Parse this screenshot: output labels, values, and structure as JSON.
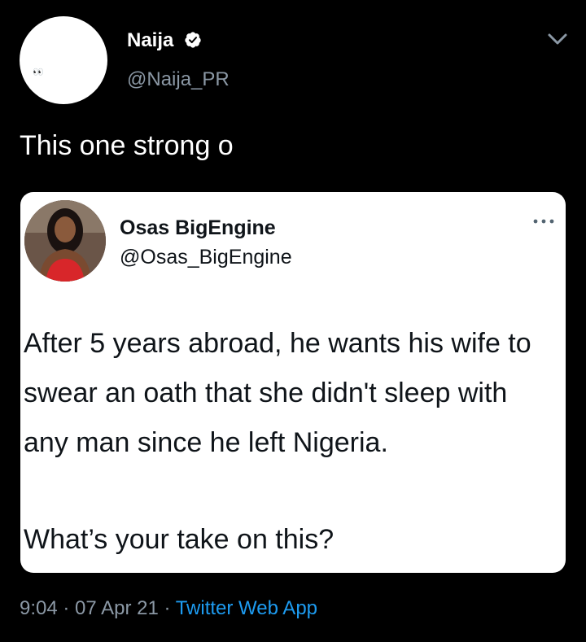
{
  "author": {
    "display_name": "Naija",
    "handle": "@Naija_PR",
    "avatar_emoji": "👀",
    "verified": true
  },
  "tweet": {
    "text": "This one strong o"
  },
  "quoted": {
    "display_name": "Osas BigEngine",
    "handle": "@Osas_BigEngine",
    "body": "After 5 years abroad, he wants his wife to swear an oath that she didn't sleep with any man since he left Nigeria.",
    "question": "What’s your take on this?"
  },
  "meta": {
    "time": "9:04",
    "separator": " · ",
    "date": "07 Apr 21",
    "separator2": " · ",
    "source": "Twitter Web App"
  },
  "colors": {
    "background": "#000000",
    "secondary_text": "#8b98a5",
    "accent": "#1d9bf0"
  },
  "icons": {
    "verified": "verified-badge-icon",
    "chevron": "chevron-down-icon",
    "more": "more-options-icon"
  }
}
